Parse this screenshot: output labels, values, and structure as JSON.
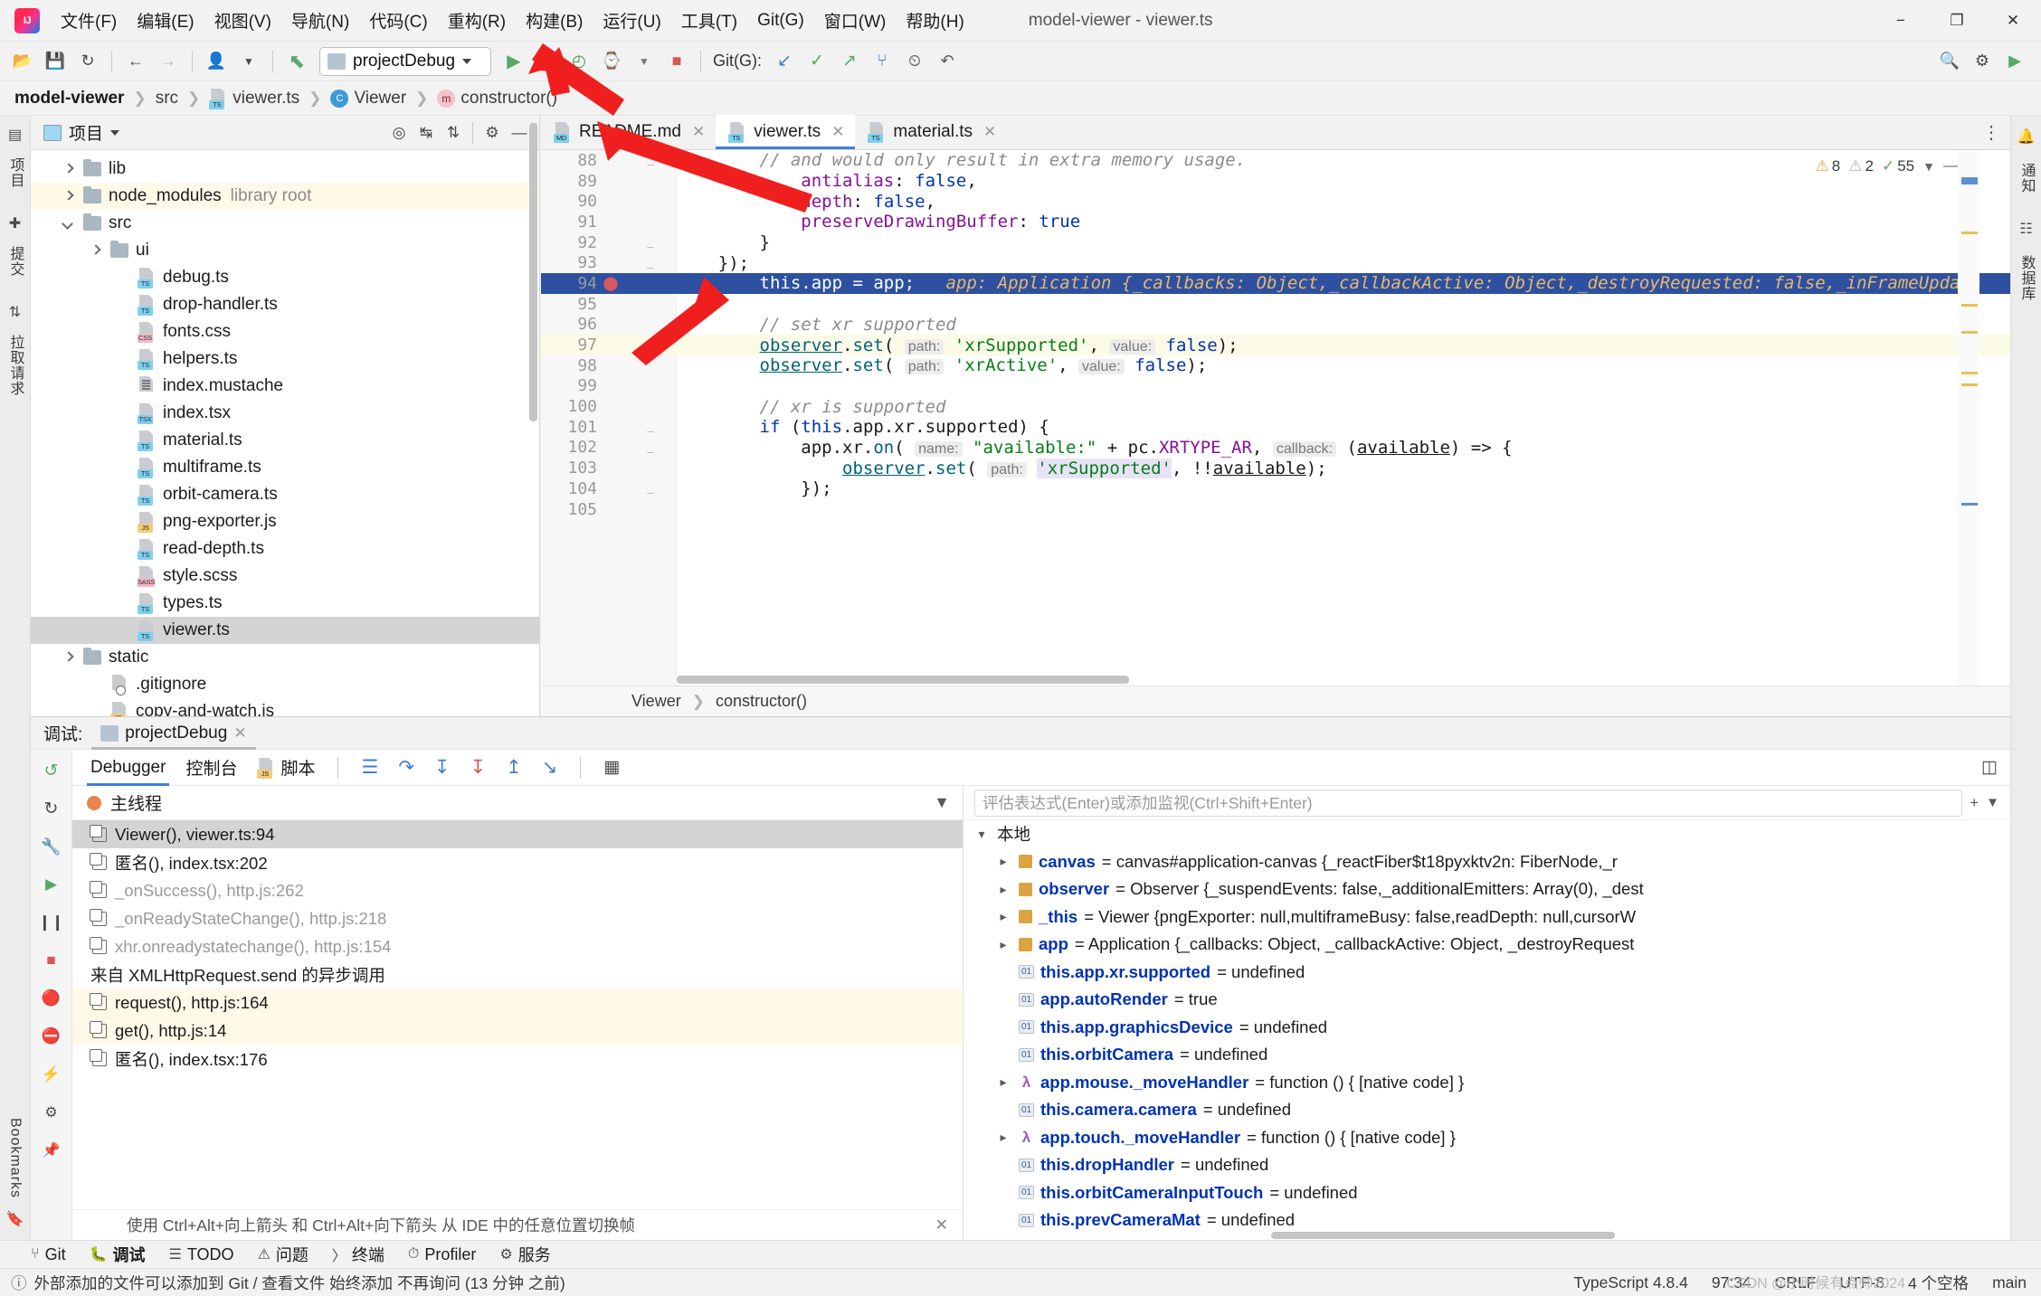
{
  "window": {
    "title": "model-viewer - viewer.ts",
    "minimize": "−",
    "maximize": "❐",
    "close": "✕"
  },
  "menu": {
    "items": [
      {
        "label": "文件(F)",
        "name": "menu-file"
      },
      {
        "label": "编辑(E)",
        "name": "menu-edit"
      },
      {
        "label": "视图(V)",
        "name": "menu-view"
      },
      {
        "label": "导航(N)",
        "name": "menu-navigate"
      },
      {
        "label": "代码(C)",
        "name": "menu-code"
      },
      {
        "label": "重构(R)",
        "name": "menu-refactor"
      },
      {
        "label": "构建(B)",
        "name": "menu-build"
      },
      {
        "label": "运行(U)",
        "name": "menu-run"
      },
      {
        "label": "工具(T)",
        "name": "menu-tools"
      },
      {
        "label": "Git(G)",
        "name": "menu-git"
      },
      {
        "label": "窗口(W)",
        "name": "menu-window"
      },
      {
        "label": "帮助(H)",
        "name": "menu-help"
      }
    ]
  },
  "toolbar": {
    "run_config": "projectDebug",
    "git_label": "Git(G):",
    "icons": {
      "open": "📂",
      "save": "💾",
      "sync": "↻",
      "back": "←",
      "forward": "→",
      "vcs_user": "👤",
      "build": "⬉",
      "run": "▶",
      "debug": "🐞",
      "coverage": "◴",
      "profile": "⌚",
      "stop": "■",
      "update": "↙",
      "commit": "✓",
      "push": "↗",
      "branch": "⑂",
      "history": "⏲",
      "rollback": "↶",
      "search": "🔍",
      "settings": "⚙",
      "run_green": "▶"
    }
  },
  "breadcrumb": {
    "items": [
      {
        "label": "model-viewer",
        "name": "breadcrumb-project",
        "kind": "project"
      },
      {
        "label": "src",
        "name": "breadcrumb-src",
        "kind": "folder"
      },
      {
        "label": "viewer.ts",
        "name": "breadcrumb-file",
        "kind": "ts"
      },
      {
        "label": "Viewer",
        "name": "breadcrumb-class",
        "kind": "class"
      },
      {
        "label": "constructor()",
        "name": "breadcrumb-method",
        "kind": "method"
      }
    ]
  },
  "left_rail": {
    "items": [
      {
        "label": "项目",
        "name": "rail-project"
      },
      {
        "label": "提交",
        "name": "rail-commit"
      },
      {
        "label": "拉取请求",
        "name": "rail-pull-requests"
      }
    ],
    "bottom": [
      {
        "label": "Bookmarks",
        "name": "rail-bookmarks"
      }
    ]
  },
  "right_rail": {
    "items": [
      {
        "label": "通知",
        "name": "rail-notifications"
      },
      {
        "label": "数据库",
        "name": "rail-database"
      }
    ]
  },
  "project_panel": {
    "title": "项目",
    "tree": [
      {
        "label": "lib",
        "type": "folder",
        "indent": 1,
        "arrow": "right",
        "name": "tree-item-lib"
      },
      {
        "label": "node_modules",
        "suffix": "library root",
        "type": "folder",
        "indent": 1,
        "arrow": "right",
        "highlight": "yellow",
        "name": "tree-item-node-modules"
      },
      {
        "label": "src",
        "type": "folder",
        "indent": 1,
        "arrow": "down",
        "name": "tree-item-src"
      },
      {
        "label": "ui",
        "type": "folder",
        "indent": 2,
        "arrow": "right",
        "name": "tree-item-ui"
      },
      {
        "label": "debug.ts",
        "type": "ts",
        "indent": 3,
        "name": "tree-item-debug-ts"
      },
      {
        "label": "drop-handler.ts",
        "type": "ts",
        "indent": 3,
        "name": "tree-item-drop-handler-ts"
      },
      {
        "label": "fonts.css",
        "type": "css",
        "indent": 3,
        "name": "tree-item-fonts-css"
      },
      {
        "label": "helpers.ts",
        "type": "ts",
        "indent": 3,
        "name": "tree-item-helpers-ts"
      },
      {
        "label": "index.mustache",
        "type": "text",
        "indent": 3,
        "name": "tree-item-index-mustache"
      },
      {
        "label": "index.tsx",
        "type": "tsx",
        "indent": 3,
        "name": "tree-item-index-tsx"
      },
      {
        "label": "material.ts",
        "type": "ts",
        "indent": 3,
        "name": "tree-item-material-ts"
      },
      {
        "label": "multiframe.ts",
        "type": "ts",
        "indent": 3,
        "name": "tree-item-multiframe-ts"
      },
      {
        "label": "orbit-camera.ts",
        "type": "ts",
        "indent": 3,
        "name": "tree-item-orbit-camera-ts"
      },
      {
        "label": "png-exporter.js",
        "type": "js",
        "indent": 3,
        "name": "tree-item-png-exporter-js"
      },
      {
        "label": "read-depth.ts",
        "type": "ts",
        "indent": 3,
        "name": "tree-item-read-depth-ts"
      },
      {
        "label": "style.scss",
        "type": "sass",
        "indent": 3,
        "name": "tree-item-style-scss"
      },
      {
        "label": "types.ts",
        "type": "ts",
        "indent": 3,
        "name": "tree-item-types-ts"
      },
      {
        "label": "viewer.ts",
        "type": "ts",
        "indent": 3,
        "selected": true,
        "name": "tree-item-viewer-ts"
      },
      {
        "label": "static",
        "type": "folder",
        "indent": 1,
        "arrow": "right",
        "name": "tree-item-static"
      },
      {
        "label": ".gitignore",
        "type": "gitignore",
        "indent": 2,
        "name": "tree-item-gitignore"
      },
      {
        "label": "copy-and-watch.js",
        "type": "js",
        "indent": 2,
        "name": "tree-item-copy-and-watch-js"
      }
    ]
  },
  "editor": {
    "tabs": [
      {
        "label": "README.md",
        "type": "md",
        "active": false,
        "name": "editor-tab-readme"
      },
      {
        "label": "viewer.ts",
        "type": "ts",
        "active": true,
        "name": "editor-tab-viewer"
      },
      {
        "label": "material.ts",
        "type": "ts",
        "active": false,
        "name": "editor-tab-material"
      }
    ],
    "inspections": {
      "warnings": "8",
      "weak_warnings": "2",
      "ok": "55"
    },
    "status_breadcrumb": [
      "Viewer",
      "constructor()"
    ],
    "code": [
      {
        "n": "88",
        "fold": true,
        "html": "        <span class=\"cmt\">// and would only result in extra memory usage.</span>"
      },
      {
        "n": "89",
        "html": "            <span class=\"prop\">antialias</span><span>: </span><span class=\"kw\">false</span><span>,</span>"
      },
      {
        "n": "90",
        "html": "            <span class=\"prop\">depth</span><span>: </span><span class=\"kw\">false</span><span>,</span>"
      },
      {
        "n": "91",
        "html": "            <span class=\"prop\">preserveDrawingBuffer</span><span>: </span><span class=\"kw\">true</span>"
      },
      {
        "n": "92",
        "fold": true,
        "html": "        }"
      },
      {
        "n": "93",
        "fold": true,
        "html": "    });"
      },
      {
        "n": "94",
        "exec": true,
        "breakpoint": true,
        "html": "        <span style=\"color:#fff\">this.app = app;</span>   <span style=\"color:#e8b86d;font-style:italic\">app: Application {_callbacks: Object,_callbackActive: Object,_destroyRequested: false,_inFrameUpdate</span>"
      },
      {
        "n": "95",
        "html": ""
      },
      {
        "n": "96",
        "html": "        <span class=\"cmt\">// set xr supported</span>"
      },
      {
        "n": "97",
        "yellow": true,
        "html": "        <span class=\"fn underline\">observer</span><span>.</span><span class=\"fn\">set</span><span>( </span><span class=\"hint\">path:</span><span> </span><span class=\"str\">'xrSupported'</span><span>, </span><span class=\"hint\">value:</span><span> </span><span class=\"kw\">false</span><span>);</span>"
      },
      {
        "n": "98",
        "html": "        <span class=\"fn underline\">observer</span><span>.</span><span class=\"fn\">set</span><span>( </span><span class=\"hint\">path:</span><span> </span><span class=\"str\">'xrActive'</span><span>, </span><span class=\"hint\">value:</span><span> </span><span class=\"kw\">false</span><span>);</span>"
      },
      {
        "n": "99",
        "html": ""
      },
      {
        "n": "100",
        "html": "        <span class=\"cmt\">// xr is supported</span>"
      },
      {
        "n": "101",
        "fold": true,
        "html": "        <span class=\"kw\">if</span><span> (</span><span class=\"kw\">this</span><span>.app.xr.supported) {</span>"
      },
      {
        "n": "102",
        "fold": true,
        "html": "            app.xr.<span class=\"fn\">on</span><span>( </span><span class=\"hint\">name:</span><span> </span><span class=\"str\">\"available:\"</span><span> + pc.</span><span class=\"prop\">XRTYPE_AR</span><span>, </span><span class=\"hint\">callback:</span><span> (</span><span class=\"underline\">available</span><span>) =&gt; {</span>"
      },
      {
        "n": "103",
        "html": "                <span class=\"fn underline\">observer</span><span>.</span><span class=\"fn\">set</span><span>( </span><span class=\"hint\">path:</span><span> </span><span class=\"str sel-light\">'xrSupported'</span><span>, !!</span><span class=\"underline\">available</span><span>);</span>"
      },
      {
        "n": "104",
        "fold": true,
        "html": "            });"
      },
      {
        "n": "105",
        "html": ""
      }
    ]
  },
  "debug_panel": {
    "label": "调试:",
    "session": "projectDebug",
    "tabs": [
      {
        "label": "Debugger",
        "active": true,
        "name": "debug-tab-debugger"
      },
      {
        "label": "控制台",
        "active": false,
        "name": "debug-tab-console"
      },
      {
        "label": "脚本",
        "active": false,
        "name": "debug-tab-scripts"
      }
    ],
    "thread": "主线程",
    "frames": [
      {
        "label": "Viewer(), viewer.ts:94",
        "selected": true,
        "name": "frame-viewer"
      },
      {
        "label": "匿名(), index.tsx:202",
        "name": "frame-anon-202"
      },
      {
        "label": "_onSuccess(), http.js:262",
        "gray": true,
        "name": "frame-onsuccess"
      },
      {
        "label": "_onReadyStateChange(), http.js:218",
        "gray": true,
        "name": "frame-onreadystatechange"
      },
      {
        "label": "xhr.onreadystatechange(), http.js:154",
        "gray": true,
        "name": "frame-xhr-onreadystatechange"
      },
      {
        "label": "来自 XMLHttpRequest.send 的异步调用",
        "async": true,
        "name": "frame-async-header"
      },
      {
        "label": "request(), http.js:164",
        "yellow": true,
        "name": "frame-request"
      },
      {
        "label": "get(), http.js:14",
        "yellow": true,
        "name": "frame-get"
      },
      {
        "label": "匿名(), index.tsx:176",
        "name": "frame-anon-176"
      }
    ],
    "eval_placeholder": "评估表达式(Enter)或添加监视(Ctrl+Shift+Enter)",
    "vars_root": "本地",
    "variables": [
      {
        "chev": true,
        "kind": "obj",
        "name": "canvas",
        "value": "= canvas#application-canvas {_reactFiber$t18pyxktv2n: FiberNode,_r",
        "dname": "var-canvas"
      },
      {
        "chev": true,
        "kind": "obj",
        "name": "observer",
        "value": "= Observer {_suspendEvents: false,_additionalEmitters: Array(0), _dest",
        "dname": "var-observer"
      },
      {
        "chev": true,
        "kind": "obj",
        "name": "_this",
        "value": "= Viewer {pngExporter: null,multiframeBusy: false,readDepth: null,cursorW",
        "dname": "var-this"
      },
      {
        "chev": true,
        "kind": "obj",
        "name": "app",
        "value": "= Application {_callbacks: Object, _callbackActive: Object, _destroyRequest",
        "dname": "var-app"
      },
      {
        "chev": false,
        "kind": "prim",
        "name": "this.app.xr.supported",
        "value": "= undefined",
        "dname": "var-app-xr-supported"
      },
      {
        "chev": false,
        "kind": "prim",
        "name": "app.autoRender",
        "value": "= true",
        "dname": "var-app-autorender"
      },
      {
        "chev": false,
        "kind": "prim",
        "name": "this.app.graphicsDevice",
        "value": "= undefined",
        "dname": "var-app-graphicsdevice"
      },
      {
        "chev": false,
        "kind": "prim",
        "name": "this.orbitCamera",
        "value": "= undefined",
        "dname": "var-orbitcamera"
      },
      {
        "chev": true,
        "kind": "fn",
        "name": "app.mouse._moveHandler",
        "value": "= function () { [native code] }",
        "dname": "var-mouse-movehandler"
      },
      {
        "chev": false,
        "kind": "prim",
        "name": "this.camera.camera",
        "value": "= undefined",
        "dname": "var-camera-camera"
      },
      {
        "chev": true,
        "kind": "fn",
        "name": "app.touch._moveHandler",
        "value": "= function () { [native code] }",
        "dname": "var-touch-movehandler"
      },
      {
        "chev": false,
        "kind": "prim",
        "name": "this.dropHandler",
        "value": "= undefined",
        "dname": "var-drophandler"
      },
      {
        "chev": false,
        "kind": "prim",
        "name": "this.orbitCameraInputTouch",
        "value": "= undefined",
        "dname": "var-orbitcamerainputtouch"
      },
      {
        "chev": false,
        "kind": "prim",
        "name": "this.prevCameraMat",
        "value": "= undefined",
        "dname": "var-prevcameramat"
      }
    ],
    "hint_text": "使用 Ctrl+Alt+向上箭头 和 Ctrl+Alt+向下箭头 从 IDE 中的任意位置切换帧"
  },
  "tool_windows": {
    "items": [
      {
        "label": "Git",
        "icon": "branch-icon",
        "name": "toolwindow-git"
      },
      {
        "label": "调试",
        "icon": "bug-icon",
        "active": true,
        "name": "toolwindow-debug"
      },
      {
        "label": "TODO",
        "icon": "list-icon",
        "name": "toolwindow-todo"
      },
      {
        "label": "问题",
        "icon": "warning-icon",
        "name": "toolwindow-problems"
      },
      {
        "label": "终端",
        "icon": "terminal-icon",
        "name": "toolwindow-terminal"
      },
      {
        "label": "Profiler",
        "icon": "profiler-icon",
        "name": "toolwindow-profiler"
      },
      {
        "label": "服务",
        "icon": "services-icon",
        "name": "toolwindow-services"
      }
    ]
  },
  "status_bar": {
    "message": "外部添加的文件可以添加到 Git / 查看文件  始终添加  不再询问 (13 分钟 之前)",
    "right": [
      {
        "label": "TypeScript 4.8.4",
        "name": "status-typescript"
      },
      {
        "label": "97:34",
        "name": "status-caret"
      },
      {
        "label": "CRLF",
        "name": "status-line-sep"
      },
      {
        "label": "UTF-8",
        "name": "status-encoding"
      },
      {
        "label": "4 个空格",
        "name": "status-indent"
      },
      {
        "label": "main",
        "name": "status-branch"
      }
    ],
    "watermark": "CSDN @小时候有点帅2024"
  }
}
